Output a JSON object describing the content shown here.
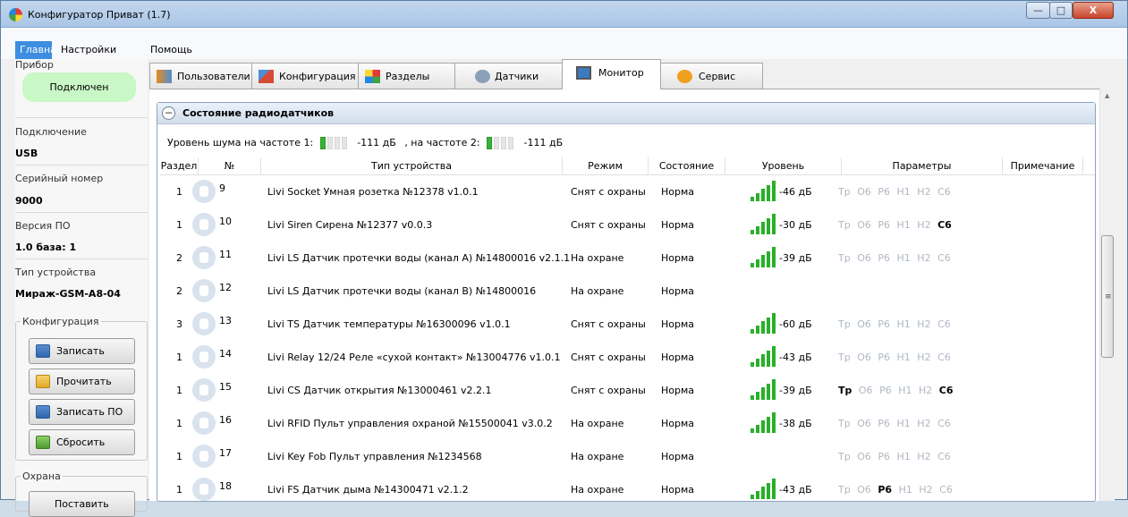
{
  "window": {
    "title": "Конфигуратор Приват (1.7)",
    "min_label": "—",
    "max_label": "□",
    "close_label": "X"
  },
  "menu": {
    "items": [
      "Главная",
      "Настройки",
      "Помощь"
    ]
  },
  "left": {
    "device_group": "Прибор",
    "connected": "Подключен",
    "connection_label": "Подключение",
    "connection_value": "USB",
    "serial_label": "Серийный номер",
    "serial_value": "9000",
    "firmware_label": "Версия ПО",
    "firmware_value": "1.0 база: 1",
    "device_type_label": "Тип устройства",
    "device_type_value": "Мираж-GSM-A8-04",
    "config_group": "Конфигурация",
    "buttons": [
      "Записать",
      "Прочитать",
      "Записать ПО",
      "Сбросить"
    ],
    "security_group": "Охрана",
    "arm_button": "Поставить"
  },
  "tabs": [
    "Пользователи",
    "Конфигурация",
    "Разделы",
    "Датчики",
    "Монитор",
    "Сервис"
  ],
  "active_tab": "Монитор",
  "panel": {
    "title": "Состояние радиодатчиков",
    "noise_prefix": "Уровень шума на частоте 1:",
    "noise1": "-111 дБ",
    "noise_sep": ", на частоте 2:",
    "noise2": "-111 дБ",
    "columns": [
      "Раздел",
      "№",
      "Тип устройства",
      "Режим",
      "Состояние",
      "Уровень",
      "Параметры",
      "Примечание"
    ],
    "rows": [
      {
        "section": "1",
        "num": "9",
        "type": "Livi Socket Умная розетка №12378 v1.0.1",
        "mode": "Снят с охраны",
        "state": "Норма",
        "level": "-46 дБ",
        "signal": 5,
        "params_active": []
      },
      {
        "section": "1",
        "num": "10",
        "type": "Livi Siren Сирена №12377 v0.0.3",
        "mode": "Снят с охраны",
        "state": "Норма",
        "level": "-30 дБ",
        "signal": 5,
        "params_active": [
          "C6"
        ]
      },
      {
        "section": "2",
        "num": "11",
        "type": "Livi LS Датчик протечки воды (канал A) №14800016 v2.1.1",
        "mode": "На охране",
        "state": "Норма",
        "level": "-39 дБ",
        "signal": 5,
        "params_active": []
      },
      {
        "section": "2",
        "num": "12",
        "type": "Livi LS Датчик протечки воды (канал B) №14800016",
        "mode": "На охране",
        "state": "Норма",
        "level": "",
        "signal": 0,
        "params_active": null
      },
      {
        "section": "3",
        "num": "13",
        "type": "Livi TS Датчик температуры №16300096 v1.0.1",
        "mode": "Снят с охраны",
        "state": "Норма",
        "level": "-60 дБ",
        "signal": 5,
        "params_active": []
      },
      {
        "section": "1",
        "num": "14",
        "type": "Livi Relay 12/24 Реле «сухой контакт» №13004776 v1.0.1",
        "mode": "Снят с охраны",
        "state": "Норма",
        "level": "-43 дБ",
        "signal": 5,
        "params_active": []
      },
      {
        "section": "1",
        "num": "15",
        "type": "Livi CS Датчик открытия №13000461 v2.2.1",
        "mode": "Снят с охраны",
        "state": "Норма",
        "level": "-39 дБ",
        "signal": 5,
        "params_active": [
          "Тр",
          "C6"
        ]
      },
      {
        "section": "1",
        "num": "16",
        "type": "Livi RFID Пульт управления охраной №15500041 v3.0.2",
        "mode": "На охране",
        "state": "Норма",
        "level": "-38 дБ",
        "signal": 5,
        "params_active": []
      },
      {
        "section": "1",
        "num": "17",
        "type": "Livi Key Fob Пульт управления №1234568",
        "mode": "На охране",
        "state": "Норма",
        "level": "",
        "signal": 0,
        "params_active": []
      },
      {
        "section": "1",
        "num": "18",
        "type": "Livi FS Датчик дыма №14300471 v2.1.2",
        "mode": "На охране",
        "state": "Норма",
        "level": "-43 дБ",
        "signal": 5,
        "params_active": [
          "P6"
        ]
      }
    ],
    "param_names": [
      "Тр",
      "O6",
      "P6",
      "H1",
      "H2",
      "C6"
    ]
  },
  "colors": {
    "accent": "#3d8ee0",
    "signal": "#28b028",
    "connected_bg": "#c9f7c6"
  }
}
